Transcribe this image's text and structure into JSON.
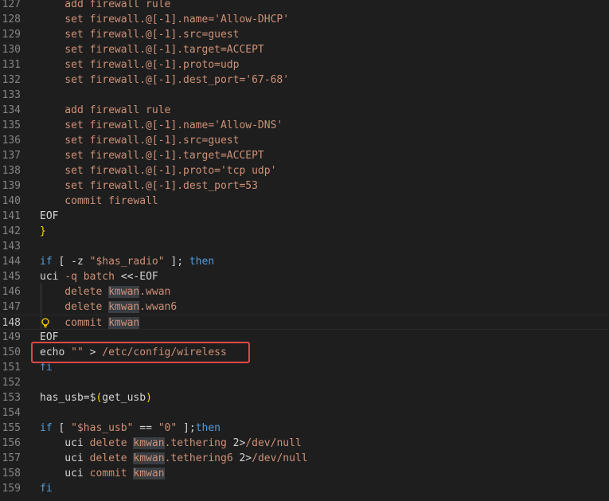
{
  "lines": [
    {
      "n": "127",
      "tokens": [
        {
          "t": "    add firewall rule",
          "c": "str"
        }
      ]
    },
    {
      "n": "128",
      "tokens": [
        {
          "t": "    set firewall.@[-1].name='Allow-DHCP'",
          "c": "str"
        }
      ]
    },
    {
      "n": "129",
      "tokens": [
        {
          "t": "    set firewall.@[-1].src=guest",
          "c": "str"
        }
      ]
    },
    {
      "n": "130",
      "tokens": [
        {
          "t": "    set firewall.@[-1].target=ACCEPT",
          "c": "str"
        }
      ]
    },
    {
      "n": "131",
      "tokens": [
        {
          "t": "    set firewall.@[-1].proto=udp",
          "c": "str"
        }
      ]
    },
    {
      "n": "132",
      "tokens": [
        {
          "t": "    set firewall.@[-1].dest_port='67-68'",
          "c": "str"
        }
      ]
    },
    {
      "n": "133",
      "tokens": []
    },
    {
      "n": "134",
      "tokens": [
        {
          "t": "    add firewall rule",
          "c": "str"
        }
      ]
    },
    {
      "n": "135",
      "tokens": [
        {
          "t": "    set firewall.@[-1].name='Allow-DNS'",
          "c": "str"
        }
      ]
    },
    {
      "n": "136",
      "tokens": [
        {
          "t": "    set firewall.@[-1].src=guest",
          "c": "str"
        }
      ]
    },
    {
      "n": "137",
      "tokens": [
        {
          "t": "    set firewall.@[-1].target=ACCEPT",
          "c": "str"
        }
      ]
    },
    {
      "n": "138",
      "tokens": [
        {
          "t": "    set firewall.@[-1].proto='tcp udp'",
          "c": "str"
        }
      ]
    },
    {
      "n": "139",
      "tokens": [
        {
          "t": "    set firewall.@[-1].dest_port=53",
          "c": "str"
        }
      ]
    },
    {
      "n": "140",
      "tokens": [
        {
          "t": "    commit firewall",
          "c": "str"
        }
      ]
    },
    {
      "n": "141",
      "tokens": [
        {
          "t": "EOF",
          "c": "plain"
        }
      ]
    },
    {
      "n": "142",
      "tokens": [
        {
          "t": "}",
          "c": "br1"
        }
      ]
    },
    {
      "n": "143",
      "tokens": []
    },
    {
      "n": "144",
      "tokens": [
        {
          "t": "if",
          "c": "kw"
        },
        {
          "t": " [ -z ",
          "c": "plain"
        },
        {
          "t": "\"$has_radio\"",
          "c": "str"
        },
        {
          "t": " ]; ",
          "c": "plain"
        },
        {
          "t": "then",
          "c": "kw"
        }
      ]
    },
    {
      "n": "145",
      "tokens": [
        {
          "t": "uci",
          "c": "plain"
        },
        {
          "t": " -q batch ",
          "c": "str"
        },
        {
          "t": "<<-EOF",
          "c": "plain"
        }
      ]
    },
    {
      "n": "146",
      "tokens": [
        {
          "t": "    delete ",
          "c": "str"
        },
        {
          "t": "kmwan",
          "c": "str sel"
        },
        {
          "t": ".wwan",
          "c": "str"
        }
      ]
    },
    {
      "n": "147",
      "tokens": [
        {
          "t": "    delete ",
          "c": "str"
        },
        {
          "t": "kmwan",
          "c": "str sel"
        },
        {
          "t": ".wwan6",
          "c": "str"
        }
      ]
    },
    {
      "n": "148",
      "tokens": [
        {
          "t": "    commit ",
          "c": "str"
        },
        {
          "t": "kmwan",
          "c": "str sel"
        }
      ],
      "current": true,
      "bulb": true
    },
    {
      "n": "149",
      "tokens": [
        {
          "t": "EOF",
          "c": "plain"
        }
      ]
    },
    {
      "n": "150",
      "tokens": [
        {
          "t": "echo ",
          "c": "plain"
        },
        {
          "t": "\"\"",
          "c": "str"
        },
        {
          "t": " > ",
          "c": "plain"
        },
        {
          "t": "/etc/config/wireless",
          "c": "str"
        }
      ]
    },
    {
      "n": "151",
      "tokens": [
        {
          "t": "fi",
          "c": "kw"
        }
      ]
    },
    {
      "n": "152",
      "tokens": []
    },
    {
      "n": "153",
      "tokens": [
        {
          "t": "has_usb=$",
          "c": "plain"
        },
        {
          "t": "(",
          "c": "br1"
        },
        {
          "t": "get_usb",
          "c": "plain"
        },
        {
          "t": ")",
          "c": "br1"
        }
      ]
    },
    {
      "n": "154",
      "tokens": []
    },
    {
      "n": "155",
      "tokens": [
        {
          "t": "if",
          "c": "kw"
        },
        {
          "t": " [ ",
          "c": "plain"
        },
        {
          "t": "\"$has_usb\"",
          "c": "str"
        },
        {
          "t": " == ",
          "c": "plain"
        },
        {
          "t": "\"0\"",
          "c": "str"
        },
        {
          "t": " ];",
          "c": "plain"
        },
        {
          "t": "then",
          "c": "kw"
        }
      ]
    },
    {
      "n": "156",
      "tokens": [
        {
          "t": "    uci ",
          "c": "plain"
        },
        {
          "t": "delete ",
          "c": "str"
        },
        {
          "t": "kmwan",
          "c": "str sel"
        },
        {
          "t": ".tethering ",
          "c": "str"
        },
        {
          "t": "2>",
          "c": "plain"
        },
        {
          "t": "/dev/null",
          "c": "str"
        }
      ]
    },
    {
      "n": "157",
      "tokens": [
        {
          "t": "    uci ",
          "c": "plain"
        },
        {
          "t": "delete ",
          "c": "str"
        },
        {
          "t": "kmwan",
          "c": "str sel"
        },
        {
          "t": ".tethering6 ",
          "c": "str"
        },
        {
          "t": "2>",
          "c": "plain"
        },
        {
          "t": "/dev/null",
          "c": "str"
        }
      ]
    },
    {
      "n": "158",
      "tokens": [
        {
          "t": "    uci ",
          "c": "plain"
        },
        {
          "t": "commit ",
          "c": "str"
        },
        {
          "t": "kmwan",
          "c": "str sel"
        }
      ]
    },
    {
      "n": "159",
      "tokens": [
        {
          "t": "fi",
          "c": "kw"
        }
      ]
    }
  ],
  "colors": {
    "background": "#1e1e1e",
    "keyword": "#569cd6",
    "string": "#ce9178",
    "text": "#d4d4d4",
    "line_number": "#858585",
    "highlight_box": "#e04848",
    "bracket": "#ffd700"
  },
  "icons": {
    "lightbulb": "lightbulb-icon"
  }
}
